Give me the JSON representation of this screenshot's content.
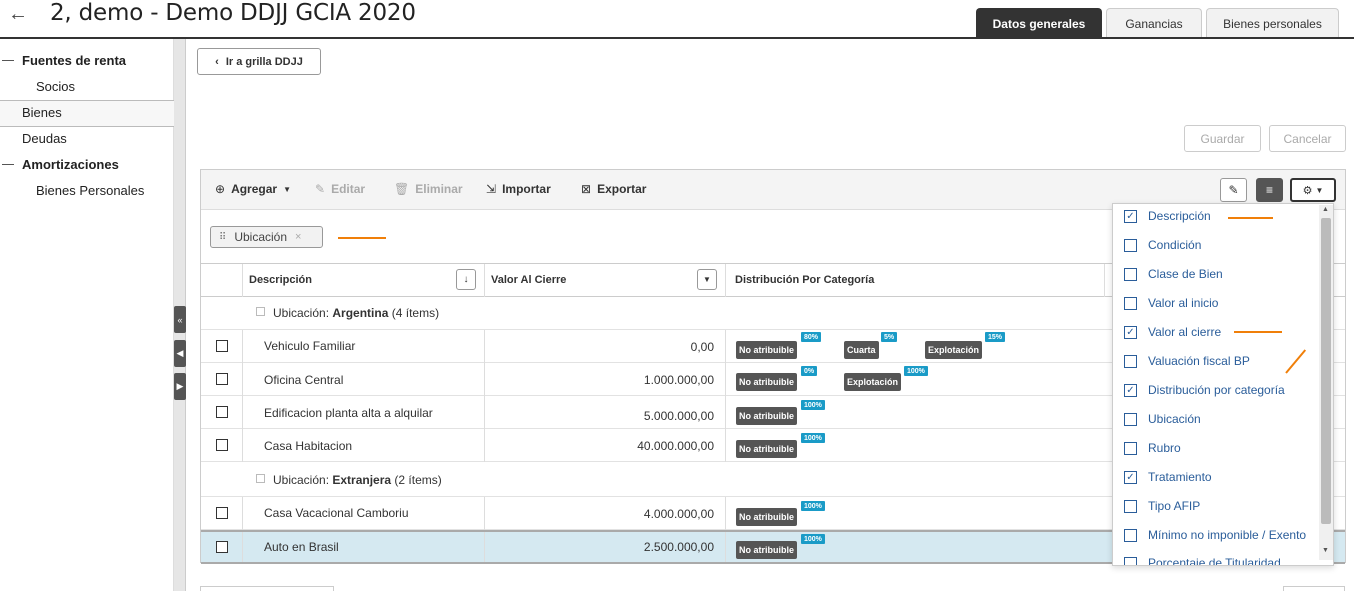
{
  "header": {
    "back_icon": "back-arrow-icon",
    "title": "2, demo - Demo DDJJ GCIA 2020",
    "tabs": [
      {
        "label": "Datos generales"
      },
      {
        "label": "Ganancias"
      },
      {
        "label": "Bienes personales"
      }
    ]
  },
  "sidebar": {
    "items": [
      {
        "label": "Fuentes de renta"
      },
      {
        "label": "Socios"
      },
      {
        "label": "Bienes"
      },
      {
        "label": "Deudas"
      },
      {
        "label": "Amortizaciones"
      },
      {
        "label": "Bienes Personales"
      }
    ]
  },
  "actions": {
    "back_grid": "Ir a grilla DDJJ",
    "save": "Guardar",
    "cancel": "Cancelar"
  },
  "toolbar": {
    "add": "Agregar",
    "edit": "Editar",
    "delete": "Eliminar",
    "import": "Importar",
    "export": "Exportar"
  },
  "group_chip": {
    "label": "Ubicación"
  },
  "columns": {
    "description": "Descripción",
    "value": "Valor Al Cierre",
    "distribution": "Distribución Por Categoría"
  },
  "groups": [
    {
      "prefix": "Ubicación: ",
      "name": "Argentina",
      "count": "(4 ítems)"
    },
    {
      "prefix": "Ubicación: ",
      "name": "Extranjera",
      "count": "(2 ítems)"
    }
  ],
  "rows": [
    {
      "description": "Vehiculo Familiar",
      "value": "0,00",
      "tags": [
        {
          "label": "No atribuible",
          "pct": "80%"
        },
        {
          "label": "Cuarta",
          "pct": "5%"
        },
        {
          "label": "Explotación",
          "pct": "15%"
        }
      ]
    },
    {
      "description": "Oficina Central",
      "value": "1.000.000,00",
      "tags": [
        {
          "label": "No atribuible",
          "pct": "0%"
        },
        {
          "label": "Explotación",
          "pct": "100%"
        }
      ]
    },
    {
      "description": "Edificacion planta alta a alquilar",
      "value": "5.000.000,00",
      "tags": [
        {
          "label": "No atribuible",
          "pct": "100%"
        }
      ]
    },
    {
      "description": "Casa Habitacion",
      "value": "40.000.000,00",
      "tags": [
        {
          "label": "No atribuible",
          "pct": "100%"
        }
      ]
    },
    {
      "description": "Casa Vacacional Camboriu",
      "value": "4.000.000,00",
      "tags": [
        {
          "label": "No atribuible",
          "pct": "100%"
        }
      ]
    },
    {
      "description": "Auto en Brasil",
      "value": "2.500.000,00",
      "tags": [
        {
          "label": "No atribuible",
          "pct": "100%"
        }
      ]
    }
  ],
  "column_chooser": [
    {
      "label": "Descripción",
      "checked": true
    },
    {
      "label": "Condición",
      "checked": false
    },
    {
      "label": "Clase de Bien",
      "checked": false
    },
    {
      "label": "Valor al inicio",
      "checked": false
    },
    {
      "label": "Valor al cierre",
      "checked": true
    },
    {
      "label": "Valuación fiscal BP",
      "checked": false
    },
    {
      "label": "Distribución por categoría",
      "checked": true
    },
    {
      "label": "Ubicación",
      "checked": false
    },
    {
      "label": "Rubro",
      "checked": false
    },
    {
      "label": "Tratamiento",
      "checked": true
    },
    {
      "label": "Tipo AFIP",
      "checked": false
    },
    {
      "label": "Mínimo no imponible / Exento",
      "checked": false
    },
    {
      "label": "Porcentaje de Titularidad",
      "checked": false
    }
  ],
  "colors": {
    "accent": "#1a9bc7",
    "annotation": "#f07f09",
    "tag": "#555555",
    "link": "#2a5d9a"
  }
}
